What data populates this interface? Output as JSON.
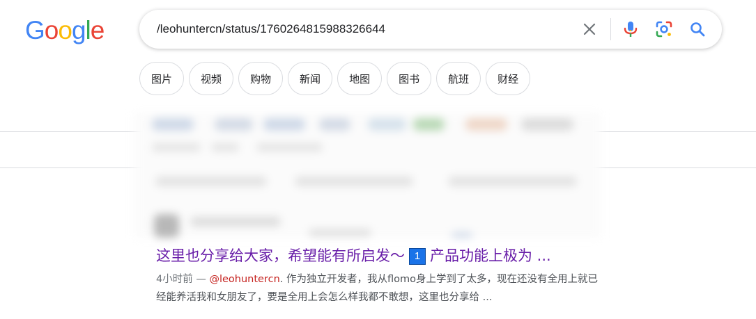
{
  "logo": {
    "letters": [
      "G",
      "o",
      "o",
      "g",
      "l",
      "e"
    ],
    "colors": [
      "#4285F4",
      "#EA4335",
      "#FBBC05",
      "#4285F4",
      "#34A853",
      "#EA4335"
    ]
  },
  "search": {
    "query": "/leohuntercn/status/1760264815988326644",
    "clear_icon": "close-icon",
    "voice_icon": "mic-icon",
    "lens_icon": "camera-lens-icon",
    "submit_icon": "search-icon"
  },
  "chips": [
    "图片",
    "视频",
    "购物",
    "新闻",
    "地图",
    "图书",
    "航班",
    "财经"
  ],
  "result": {
    "title_before": "这里也分享给大家，希望能有所启发～",
    "title_keycap": "1",
    "title_after": "产品功能上极为 ...",
    "date": "4小时前",
    "separator": "—",
    "handle": "@leohuntercn",
    "snippet_line1": ". 作为独立开发者，我从flomo身上学到了太多，现在还没有全用上就已",
    "snippet_line2": "经能养活我和女朋友了，要是全用上会怎么样我都不敢想，这里也分享给 ..."
  },
  "colors": {
    "title_link": "#681da8",
    "handle": "#c5221f",
    "chip_border": "#dadce0",
    "accent_blue": "#1a73e8"
  }
}
